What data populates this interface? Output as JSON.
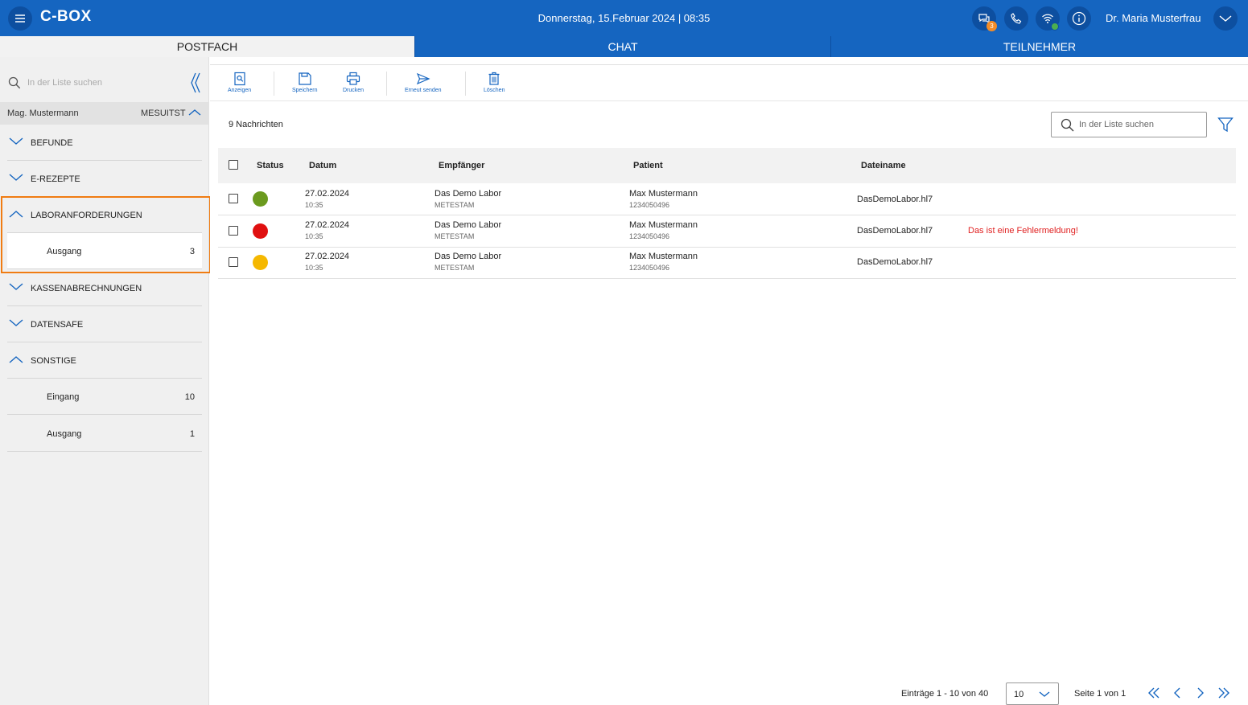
{
  "header": {
    "app_title": "C-BOX",
    "datetime": "Donnerstag, 15.Februar 2024 | 08:35",
    "chat_badge": "3",
    "user_name": "Dr. Maria Musterfrau",
    "accent_color": "#1565c0"
  },
  "tabs": [
    {
      "label": "POSTFACH",
      "active": true
    },
    {
      "label": "CHAT",
      "active": false
    },
    {
      "label": "TEILNEHMER",
      "active": false
    }
  ],
  "sidebar": {
    "search_placeholder": "In der Liste suchen",
    "account_name": "Mag. Mustermann",
    "account_code": "MESUITST",
    "sections": [
      {
        "label": "BEFUNDE",
        "expanded": false
      },
      {
        "label": "E-REZEPTE",
        "expanded": false
      },
      {
        "label": "LABORANFORDERUNGEN",
        "expanded": true,
        "items": [
          {
            "label": "Ausgang",
            "count": "3"
          }
        ]
      },
      {
        "label": "KASSENABRECHNUNGEN",
        "expanded": false
      },
      {
        "label": "DATENSAFE",
        "expanded": false
      },
      {
        "label": "SONSTIGE",
        "expanded": true,
        "items": [
          {
            "label": "Eingang",
            "count": "10"
          },
          {
            "label": "Ausgang",
            "count": "1"
          }
        ]
      }
    ]
  },
  "toolbar": {
    "view": "Anzeigen",
    "save": "Speichern",
    "print": "Drucken",
    "resend": "Erneut senden",
    "delete": "Löschen"
  },
  "main": {
    "message_count": "9 Nachrichten",
    "search_placeholder": "In der Liste suchen"
  },
  "table": {
    "columns": [
      "Status",
      "Datum",
      "Empfänger",
      "Patient",
      "Dateiname"
    ],
    "rows": [
      {
        "status_color": "#6b9a1e",
        "date": "27.02.2024",
        "time": "10:35",
        "recipient": "Das Demo Labor",
        "recipient_id": "METESTAM",
        "patient": "Max Mustermann",
        "patient_id": "1234050496",
        "filename": "DasDemoLabor.hl7",
        "message": ""
      },
      {
        "status_color": "#e01010",
        "date": "27.02.2024",
        "time": "10:35",
        "recipient": "Das Demo Labor",
        "recipient_id": "METESTAM",
        "patient": "Max Mustermann",
        "patient_id": "1234050496",
        "filename": "DasDemoLabor.hl7",
        "message": "Das ist eine Fehlermeldung!"
      },
      {
        "status_color": "#f5b800",
        "date": "27.02.2024",
        "time": "10:35",
        "recipient": "Das Demo Labor",
        "recipient_id": "METESTAM",
        "patient": "Max Mustermann",
        "patient_id": "1234050496",
        "filename": "DasDemoLabor.hl7",
        "message": ""
      }
    ]
  },
  "pagination": {
    "entries": "Einträge 1 - 10 von 40",
    "page_size": "10",
    "page_of": "Seite 1 von 1"
  },
  "icons": [
    "menu-icon",
    "chat-icon",
    "phone-icon",
    "wifi-icon",
    "info-icon",
    "chevron-down-icon",
    "search-icon",
    "collapse-sidebar-icon",
    "filter-icon",
    "view-icon",
    "save-icon",
    "print-icon",
    "send-icon",
    "trash-icon"
  ]
}
